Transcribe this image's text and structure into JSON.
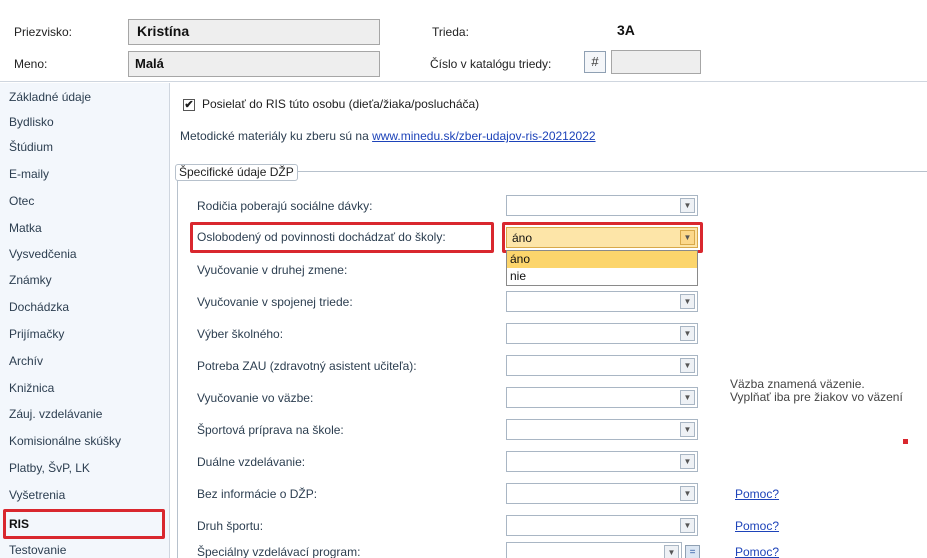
{
  "header": {
    "surname_label": "Priezvisko:",
    "surname_value": "Kristína",
    "firstname_label": "Meno:",
    "firstname_value": "Malá",
    "class_label": "Trieda:",
    "class_value": "3A",
    "catalog_label": "Číslo v katalógu triedy:",
    "catalog_button": "#",
    "catalog_value": ""
  },
  "sidebar": {
    "items": [
      {
        "label": "Základné údaje"
      },
      {
        "label": "Bydlisko"
      },
      {
        "label": "Štúdium"
      },
      {
        "label": "E-maily"
      },
      {
        "label": "Otec"
      },
      {
        "label": "Matka"
      },
      {
        "label": "Vysvedčenia"
      },
      {
        "label": "Známky"
      },
      {
        "label": "Dochádzka"
      },
      {
        "label": "Prijímačky"
      },
      {
        "label": "Archív"
      },
      {
        "label": "Knižnica"
      },
      {
        "label": "Záuj. vzdelávanie"
      },
      {
        "label": "Komisionálne skúšky"
      },
      {
        "label": "Platby, ŠvP, LK"
      },
      {
        "label": "Vyšetrenia"
      },
      {
        "label": "RIS"
      },
      {
        "label": "Testovanie"
      }
    ],
    "active": "RIS"
  },
  "main": {
    "send_checkbox_label": "Posielať do RIS túto osobu (dieťa/žiaka/poslucháča)",
    "send_checked": true,
    "method_text": "Metodické materiály ku zberu sú na ",
    "method_link": "www.minedu.sk/zber-udajov-ris-20212022",
    "group_title": "Špecifické údaje DŽP",
    "rows": [
      {
        "label": "Rodičia poberajú sociálne dávky:",
        "value": ""
      },
      {
        "label": "Oslobodený od povinnosti dochádzať do školy:",
        "value": "áno"
      },
      {
        "label": "Vyučovanie v druhej zmene:",
        "value": ""
      },
      {
        "label": "Vyučovanie v spojenej triede:",
        "value": ""
      },
      {
        "label": "Výber školného:",
        "value": ""
      },
      {
        "label": "Potreba ZAU (zdravotný asistent učiteľa):",
        "value": ""
      },
      {
        "label": "Vyučovanie vo väzbe:",
        "value": ""
      },
      {
        "label": "Športová príprava na škole:",
        "value": ""
      },
      {
        "label": "Duálne vzdelávanie:",
        "value": ""
      },
      {
        "label": "Bez informácie o DŽP:",
        "value": ""
      },
      {
        "label": "Druh športu:",
        "value": ""
      },
      {
        "label": "Špeciálny vzdelávací program:",
        "value": ""
      }
    ],
    "dropdown_options": [
      "áno",
      "nie"
    ],
    "dropdown_selected": "áno",
    "note_line1": "Väzba znamená väzenie.",
    "note_line2": "Vyplňať iba pre žiakov vo väzení",
    "help_label": "Pomoc?",
    "eq_button": "="
  },
  "colors": {
    "highlight": "#d9272e",
    "link": "#1d43b9",
    "dropdown_selected_bg": "#fcd56c"
  }
}
